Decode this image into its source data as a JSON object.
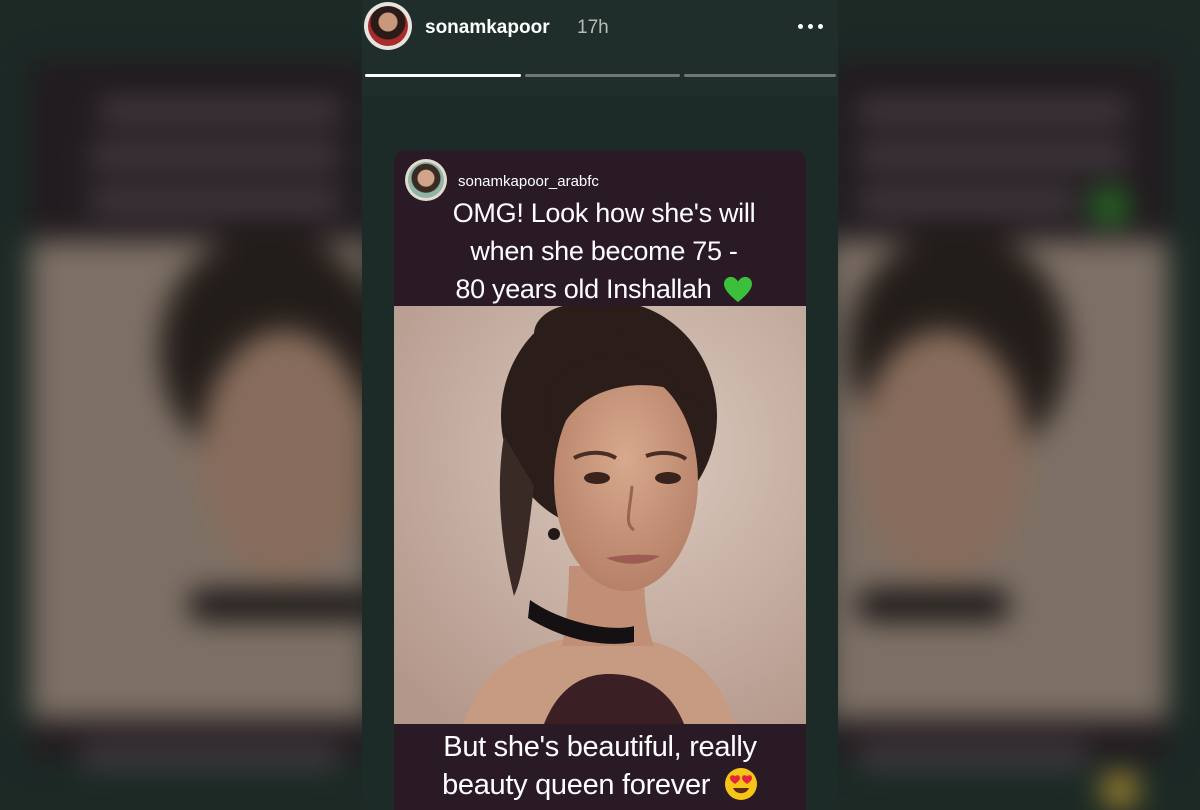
{
  "story": {
    "username": "sonamkapoor",
    "time": "17h",
    "more_icon": "more-horizontal-icon",
    "progress": [
      1.0,
      0.0,
      0.0
    ]
  },
  "repost": {
    "username": "sonamkapoor_arabfc",
    "caption_top_lines": [
      "OMG! Look how she's will",
      "when she become 75 -",
      "80 years old Inshallah"
    ],
    "caption_top_emoji": "green-heart-icon",
    "caption_bottom_lines": [
      "But she's beautiful, really",
      "beauty queen forever"
    ],
    "caption_bottom_emoji": "heart-eyes-emoji-icon"
  },
  "colors": {
    "background": "#1c2b27",
    "card": "#2a1a26",
    "heart": "#3cbf3a",
    "emoji": "#f5c518"
  }
}
